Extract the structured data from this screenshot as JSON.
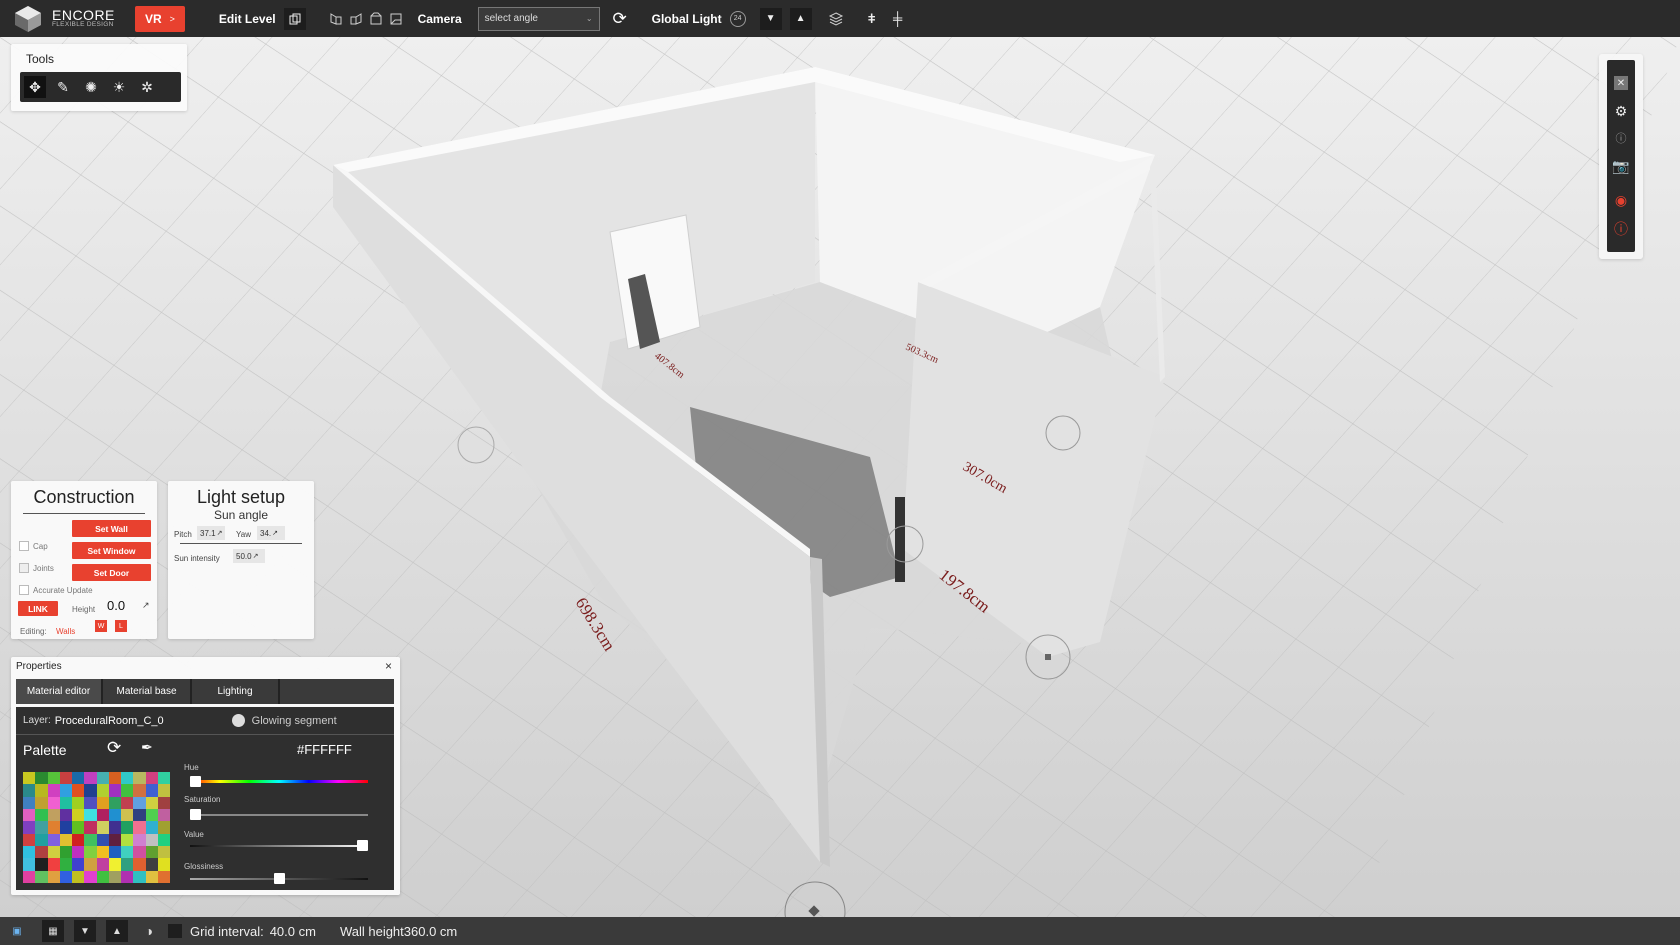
{
  "app": {
    "name": "ENCORE",
    "tagline": "FLEXIBLE DESIGN",
    "vr_label": "VR",
    "vr_arrow": ">"
  },
  "toolbar": {
    "edit_level": "Edit Level",
    "camera": "Camera",
    "angle_placeholder": "select angle",
    "global_light": "Global Light",
    "global_light_badge": "24"
  },
  "tools_panel": {
    "title": "Tools"
  },
  "construction": {
    "title": "Construction",
    "set_wall": "Set Wall",
    "set_window": "Set Window",
    "set_door": "Set Door",
    "cap": "Cap",
    "joints": "Joints",
    "accurate_update": "Accurate Update",
    "link": "LINK",
    "height_label": "Height",
    "height_value": "0.0",
    "editing_label": "Editing:",
    "editing_value": "Walls",
    "w": "W",
    "l": "L"
  },
  "light_setup": {
    "title": "Light setup",
    "subtitle": "Sun angle",
    "pitch_label": "Pitch",
    "pitch_value": "37.1",
    "yaw_label": "Yaw",
    "yaw_value": "34.",
    "intensity_label": "Sun intensity",
    "intensity_value": "50.0"
  },
  "properties": {
    "title": "Properties",
    "close": "×",
    "tabs": [
      "Material editor",
      "Material base",
      "Lighting"
    ],
    "layer_label": "Layer:",
    "layer_value": "ProceduralRoom_C_0",
    "glowing_segment": "Glowing segment",
    "palette": "Palette",
    "hex": "#FFFFFF",
    "hue": "Hue",
    "saturation": "Saturation",
    "value": "Value",
    "glossiness": "Glossiness",
    "levels": {
      "hue": 0,
      "saturation": 0,
      "value": 1.0,
      "glossiness": 0.5
    },
    "swatch_colors": [
      "#c8c820",
      "#2a8a30",
      "#56c23a",
      "#c84040",
      "#1a6aa8",
      "#c040c0",
      "#46b0b0",
      "#d86020",
      "#30c8c8",
      "#b8b860",
      "#d04080",
      "#30d0a0",
      "#2a8a8a",
      "#b8b820",
      "#d040c0",
      "#30a0e0",
      "#e05020",
      "#204090",
      "#b0d030",
      "#a030c0",
      "#40c040",
      "#d07040",
      "#4060d0",
      "#c0c040",
      "#4080c0",
      "#c0a030",
      "#f060d0",
      "#20c0a0",
      "#a0d020",
      "#5050c0",
      "#e0a020",
      "#30a060",
      "#c04050",
      "#60a0e0",
      "#d0d040",
      "#a04040",
      "#e060c0",
      "#30c050",
      "#c0a060",
      "#6030a0",
      "#d0d020",
      "#40e0e0",
      "#b02060",
      "#2090d0",
      "#d0c050",
      "#304080",
      "#50d050",
      "#c060a0",
      "#8040c0",
      "#40a0a0",
      "#e08030",
      "#2040a0",
      "#60c020",
      "#c03060",
      "#d0d060",
      "#403090",
      "#20a060",
      "#f07090",
      "#30b0d0",
      "#a0a030",
      "#d04040",
      "#20a0a0",
      "#8060e0",
      "#e0c030",
      "#d02020",
      "#40c060",
      "#3050b0",
      "#602040",
      "#b0e040",
      "#d080d0",
      "#c0c0c0",
      "#20d080",
      "#30c0e0",
      "#b04040",
      "#d0d040",
      "#30a030",
      "#c030c0",
      "#80d040",
      "#f0c020",
      "#2060c0",
      "#40d0c0",
      "#d050a0",
      "#60a030",
      "#c0c040",
      "#40c0e0",
      "#202020",
      "#f04040",
      "#30b040",
      "#4040d0",
      "#d0a040",
      "#c040a0",
      "#f0f030",
      "#30a080",
      "#e06030",
      "#404040",
      "#e0e020",
      "#e040a0",
      "#60c060",
      "#e0a040",
      "#3060e0",
      "#c0c020",
      "#e040d0",
      "#40c040",
      "#a0a060",
      "#b030b0",
      "#30c0c0",
      "#e0c040",
      "#e07030"
    ]
  },
  "measurements": [
    "698.3cm",
    "197.8cm",
    "307.0cm",
    "503.3cm",
    "407.8cm"
  ],
  "statusbar": {
    "grid_label": "Grid interval:",
    "grid_value": "40.0 cm",
    "wall_label": "Wall height",
    "wall_value": "360.0 cm"
  },
  "colors": {
    "accent": "#e8412f",
    "topbar": "#2b2b2b",
    "floor": "#dadada",
    "wall": "#f0f0f0"
  }
}
